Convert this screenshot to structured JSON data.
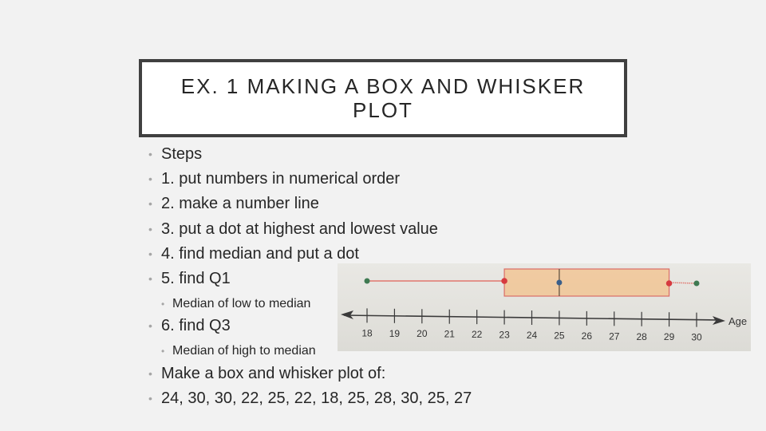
{
  "slide": {
    "title": "EX. 1 MAKING A BOX AND WHISKER PLOT",
    "bullets": [
      {
        "level": 1,
        "text": "Steps"
      },
      {
        "level": 1,
        "text": "1. put numbers in numerical order"
      },
      {
        "level": 1,
        "text": "2. make a number line"
      },
      {
        "level": 1,
        "text": "3. put a dot at highest and lowest value"
      },
      {
        "level": 1,
        "text": "4. find median and put a dot"
      },
      {
        "level": 1,
        "text": "5. find Q1"
      },
      {
        "level": 2,
        "text": "Median of low to median"
      },
      {
        "level": 1,
        "text": "6. find Q3"
      },
      {
        "level": 2,
        "text": "Median of high to median"
      },
      {
        "level": 1,
        "text": "Make a box and whisker plot of:"
      },
      {
        "level": 1,
        "text": "24, 30, 30, 22, 25, 22, 18, 25, 28, 30, 25, 27"
      }
    ],
    "bullet_glyph": "•"
  },
  "chart_data": {
    "type": "boxplot",
    "title": "",
    "xlabel": "Age",
    "ylabel": "",
    "xlim": [
      18,
      30
    ],
    "ticks": [
      18,
      19,
      20,
      21,
      22,
      23,
      24,
      25,
      26,
      27,
      28,
      29,
      30
    ],
    "tick_labels": [
      "18",
      "19",
      "20",
      "21",
      "22",
      "23",
      "24",
      "25",
      "26",
      "27",
      "28",
      "29",
      "30"
    ],
    "min": 18,
    "q1": 23,
    "median": 25,
    "q3": 29,
    "max": 30,
    "colors": {
      "box_fill": "#f1c89a",
      "box_stroke": "#d9605a",
      "whisker": "#e0766e",
      "extreme_dot": "#3f7a52",
      "quartile_dot": "#d63a3f",
      "median_dot": "#3a5f8a",
      "axis": "#3a3a3a"
    }
  }
}
